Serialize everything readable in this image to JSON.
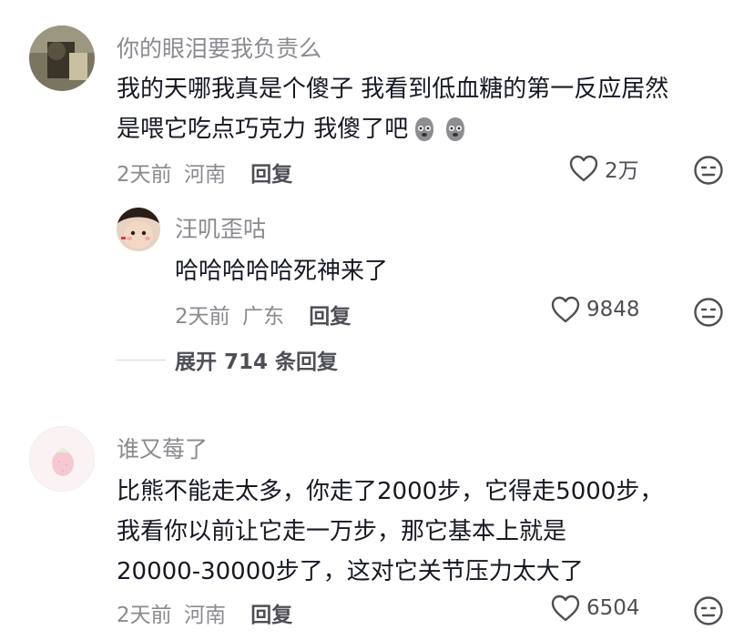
{
  "comments": [
    {
      "username": "你的眼泪要我负责么",
      "lines": [
        "我的天哪我真是个傻子 我看到低血糖的第一反应居然",
        "是喂它吃点巧克力 我傻了吧"
      ],
      "emoji": [
        "worried-face-emoji",
        "worried-face-emoji"
      ],
      "time": "2天前",
      "location": "河南",
      "reply_label": "回复",
      "likes": "2万",
      "reply": {
        "username": "汪叽歪咕",
        "text": "哈哈哈哈哈死神来了",
        "time": "2天前",
        "location": "广东",
        "reply_label": "回复",
        "likes": "9848"
      },
      "expand_label": "展开 714 条回复"
    },
    {
      "username": "谁又莓了",
      "lines": [
        "比熊不能走太多，你走了2000步，它得走5000步，",
        "我看你以前让它走一万步，那它基本上就是",
        "20000-30000步了，这对它关节压力太大了"
      ],
      "time": "2天前",
      "location": "河南",
      "reply_label": "回复",
      "likes": "6504"
    }
  ],
  "icons": {
    "like": "heart-outline-icon",
    "dislike": "meh-face-icon"
  },
  "colors": {
    "text_primary": "#161823",
    "text_secondary": "#8a8b91",
    "action": "#4e4f55"
  }
}
